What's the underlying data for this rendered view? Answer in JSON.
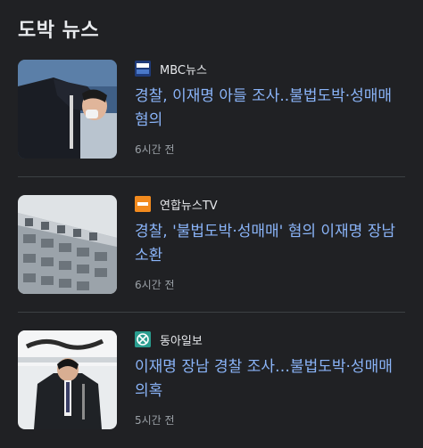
{
  "section": {
    "title": "도박 뉴스"
  },
  "articles": [
    {
      "source": "MBC뉴스",
      "source_logo_text": "MBC NEWS",
      "headline": "경찰, 이재명 아들 조사..불법도박·성매매 혐의",
      "time": "6시간 전",
      "logo_color": "#1f3b7a"
    },
    {
      "source": "연합뉴스TV",
      "source_logo_text": "연합뉴스TV",
      "headline": "경찰, '불법도박·성매매' 혐의 이재명 장남 소환",
      "time": "6시간 전",
      "logo_color": "#f28a1e"
    },
    {
      "source": "동아일보",
      "source_logo_text": "",
      "headline": "이재명 장남 경찰 조사…불법도박·성매매 의혹",
      "time": "5시간 전",
      "logo_color": "#2a9d8f"
    }
  ]
}
